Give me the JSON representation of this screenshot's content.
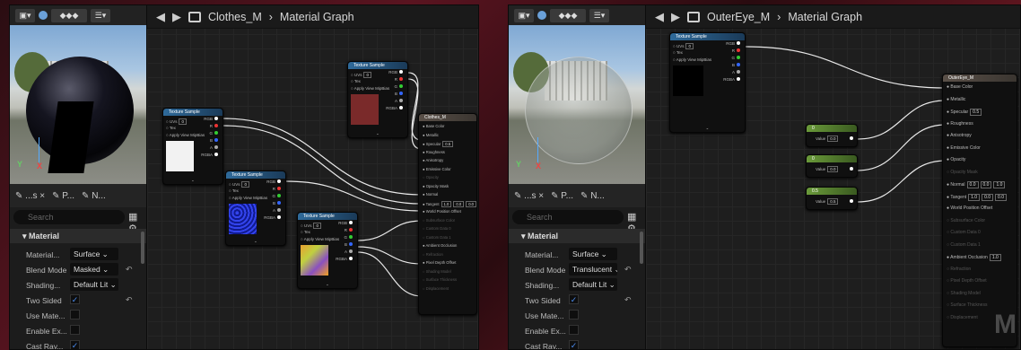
{
  "left": {
    "graph_title": "Clothes_M",
    "graph_suffix": "Material Graph",
    "tabs": [
      "...s ×",
      "P...",
      "N..."
    ],
    "search_placeholder": "Search",
    "section": "Material",
    "props": [
      {
        "label": "Material...",
        "value": "Surface",
        "type": "dropdown"
      },
      {
        "label": "Blend Mode",
        "value": "Masked",
        "type": "dropdown",
        "reset": true
      },
      {
        "label": "Shading...",
        "value": "Default Lit",
        "type": "dropdown"
      },
      {
        "label": "Two Sided",
        "checked": true,
        "type": "check",
        "reset": true
      },
      {
        "label": "Use Mate...",
        "checked": false,
        "type": "check"
      },
      {
        "label": "Enable Ex...",
        "checked": false,
        "type": "check"
      },
      {
        "label": "Cast Ray...",
        "checked": true,
        "type": "check"
      }
    ],
    "texture_node_title": "Texture Sample",
    "texture_inputs": [
      "UVs",
      "Tex",
      "Apply View MipBias"
    ],
    "texture_outputs": [
      "RGB",
      "R",
      "G",
      "B",
      "A",
      "RGBA"
    ],
    "uv_value": "0",
    "result_node_title": "Clothes_M",
    "result_pins": [
      "Base Color",
      "Metallic",
      "Specular",
      "Roughness",
      "Anisotropy",
      "Emissive Color",
      "Opacity",
      "Opacity Mask",
      "Normal",
      "Tangent",
      "World Position Offset",
      "Subsurface Color",
      "Custom Data 0",
      "Custom Data 1",
      "Ambient Occlusion",
      "Refraction",
      "Pixel Depth Offset",
      "Shading Model",
      "Surface Thickness",
      "Displacement"
    ],
    "specular_value": "0.5",
    "tangent_values": [
      "1.0",
      "0.0",
      "0.0"
    ]
  },
  "right": {
    "graph_title": "OuterEye_M",
    "graph_suffix": "Material Graph",
    "tabs": [
      "...s ×",
      "P...",
      "N..."
    ],
    "search_placeholder": "Search",
    "section": "Material",
    "props": [
      {
        "label": "Material...",
        "value": "Surface",
        "type": "dropdown"
      },
      {
        "label": "Blend Mode",
        "value": "Translucent",
        "type": "dropdown",
        "reset": true
      },
      {
        "label": "Shading...",
        "value": "Default Lit",
        "type": "dropdown"
      },
      {
        "label": "Two Sided",
        "checked": true,
        "type": "check",
        "reset": true
      },
      {
        "label": "Use Mate...",
        "checked": false,
        "type": "check"
      },
      {
        "label": "Enable Ex...",
        "checked": false,
        "type": "check"
      },
      {
        "label": "Cast Ray...",
        "checked": true,
        "type": "check"
      }
    ],
    "texture_node_title": "Texture Sample",
    "texture_inputs": [
      "UVs",
      "Tex",
      "Apply View MipBias"
    ],
    "texture_outputs": [
      "RGB",
      "R",
      "G",
      "B",
      "A",
      "RGBA"
    ],
    "uv_value": "0",
    "const_nodes": [
      {
        "title": "0",
        "label": "Value",
        "value": "0.0"
      },
      {
        "title": "0",
        "label": "Value",
        "value": "0.0"
      },
      {
        "title": "0.5",
        "label": "Value",
        "value": "0.5"
      }
    ],
    "result_node_title": "OuterEye_M",
    "result_pins": [
      "Base Color",
      "Metallic",
      "Specular",
      "Roughness",
      "Anisotropy",
      "Emissive Color",
      "Opacity",
      "Opacity Mask",
      "Normal",
      "Tangent",
      "World Position Offset",
      "Subsurface Color",
      "Custom Data 0",
      "Custom Data 1",
      "Ambient Occlusion",
      "Refraction",
      "Pixel Depth Offset",
      "Shading Model",
      "Surface Thickness",
      "Displacement"
    ],
    "specular_value": "0.5",
    "normal_values": [
      "0.0",
      "0.0",
      "1.0"
    ],
    "tangent_values": [
      "1.0",
      "0.0",
      "0.0"
    ],
    "ao_value": "1.0"
  },
  "watermark": "M",
  "colors": {
    "accent": "#4a8cf0",
    "texture_header": "#2f6a9a",
    "const_header": "#6a9a3a"
  }
}
